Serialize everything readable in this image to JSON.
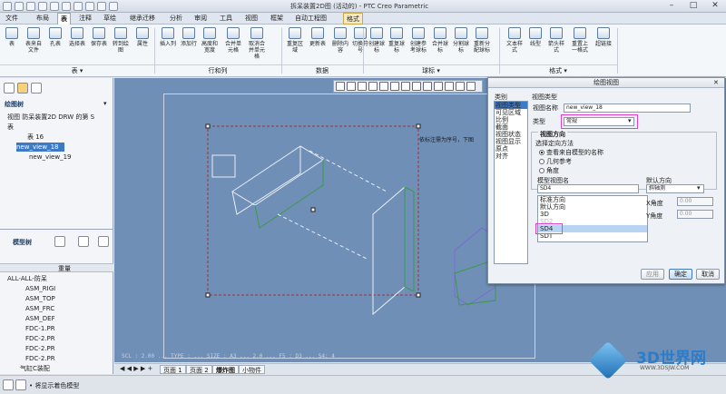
{
  "window": {
    "title": "拆呆装置2D图 (活动的) - PTC Creo Parametric",
    "min": "–",
    "max": "□",
    "close": "✕"
  },
  "tabs": [
    "文件",
    "布局",
    "表",
    "注释",
    "草绘",
    "继承迁移",
    "分析",
    "审阅",
    "工具",
    "视图",
    "框架",
    "自动工程图",
    "格式"
  ],
  "active_tab": "表",
  "ribbon": {
    "buttons": [
      {
        "label": "表",
        "icon": "table-icon"
      },
      {
        "label": "表来自文件",
        "icon": "table-file-icon"
      },
      {
        "label": "孔表",
        "icon": "hole-table-icon"
      },
      {
        "label": "选择表",
        "icon": "select-table-icon"
      },
      {
        "label": "保存表",
        "icon": "save-table-icon"
      },
      {
        "label": "转到绘图",
        "icon": "goto-drawing-icon"
      },
      {
        "label": "属性",
        "icon": "properties-icon"
      },
      {
        "label": "插入列",
        "icon": "insert-column-icon"
      },
      {
        "label": "添加行",
        "icon": "add-row-icon"
      },
      {
        "label": "高度和宽度",
        "icon": "height-width-icon"
      },
      {
        "label": "合并单元格",
        "icon": "merge-cells-icon"
      },
      {
        "label": "取消合并单元格",
        "icon": "unmerge-icon"
      },
      {
        "label": "重复区域",
        "icon": "repeat-region-icon"
      },
      {
        "label": "更新表",
        "icon": "update-table-icon"
      },
      {
        "label": "删除内容",
        "icon": "delete-content-icon"
      },
      {
        "label": "切换符号",
        "icon": "switch-symbol-icon"
      },
      {
        "label": "创建球标",
        "icon": "balloon-icon"
      },
      {
        "label": "重复球标",
        "icon": "repeat-balloon-icon"
      },
      {
        "label": "创建参考球标",
        "icon": "ref-balloon-icon"
      },
      {
        "label": "合并球标",
        "icon": "merge-balloon-icon"
      },
      {
        "label": "分割球标",
        "icon": "split-balloon-icon"
      },
      {
        "label": "重新分配球标",
        "icon": "reassign-balloon-icon"
      },
      {
        "label": "文本样式",
        "icon": "text-style-icon"
      },
      {
        "label": "线型",
        "icon": "line-style-icon"
      },
      {
        "label": "箭头样式",
        "icon": "arrow-style-icon"
      },
      {
        "label": "重置上一格式",
        "icon": "reset-format-icon"
      },
      {
        "label": "超链接",
        "icon": "hyperlink-icon"
      }
    ],
    "groups": [
      "表 ▾",
      "行和列",
      "数据",
      "球标 ▾",
      "格式 ▾"
    ]
  },
  "left_panel": {
    "drawing_tree_title": "绘图树",
    "drawing_tree_items": [
      "视图 防呆装置2D DRW 的第 S",
      "表",
      "表 16",
      "new_view_18",
      "new_view_19"
    ],
    "model_tree_title": "模型树",
    "model_tree_header": "重量",
    "model_tree_items": [
      "ALL-ALL-防呆",
      "ASM_RIGI",
      "ASM_TOP",
      "ASM_FRC",
      "ASM_DEF",
      "FDC-1.PR",
      "FDC-2.PR",
      "FDC-2.PR",
      "FDC-2.PR",
      "气缸C装配"
    ]
  },
  "canvas": {
    "note": "依标注需为序号，下图",
    "status_line": "SCL : 2.00  ...  TYPE : ...  SIZE : A3  ...  2.0  ...  F5 : D3  ...  S4: 4"
  },
  "dialog": {
    "title": "绘图视图",
    "categories_label": "类别",
    "categories": [
      "视图类型",
      "可见区域",
      "比例",
      "截面",
      "视图状态",
      "视图显示",
      "原点",
      "对齐"
    ],
    "view_type_label": "视图类型",
    "view_name_label": "视图名称",
    "view_name_value": "new_view_18",
    "type_label": "类型",
    "type_value": "常规",
    "orientation_label": "视图方向",
    "orientation_method_label": "选择定向方法",
    "orientation_options": [
      "查看来自模型的名称",
      "几何参考",
      "角度"
    ],
    "orientation_selected": 0,
    "model_view_label": "模型视图名",
    "model_view_input": "SD4",
    "model_view_list": [
      "标准方向",
      "默认方向",
      "3D",
      "SD2",
      "SD4",
      "SDT"
    ],
    "model_view_selected": "SD4",
    "default_orient_label": "默认方向",
    "default_orient_value": "斜轴测",
    "x_angle_label": "X角度",
    "x_angle_value": "0.00",
    "y_angle_label": "Y角度",
    "y_angle_value": "0.00",
    "apply": "应用",
    "ok": "确定",
    "cancel": "取消"
  },
  "sheet_tabs": [
    "页面 1",
    "页面 2",
    "爆炸图",
    "小物件"
  ],
  "active_sheet": "爆炸图",
  "status": {
    "message": "• 将显示着色模型",
    "watermark": "3D世界网",
    "watermark_url": "WWW.3DSJW.COM"
  },
  "colors": {
    "canvas": "#6f8fb6",
    "selection": "#3e79c6",
    "highlight": "#e33fd1",
    "part_outline": "#2e8b3a"
  }
}
